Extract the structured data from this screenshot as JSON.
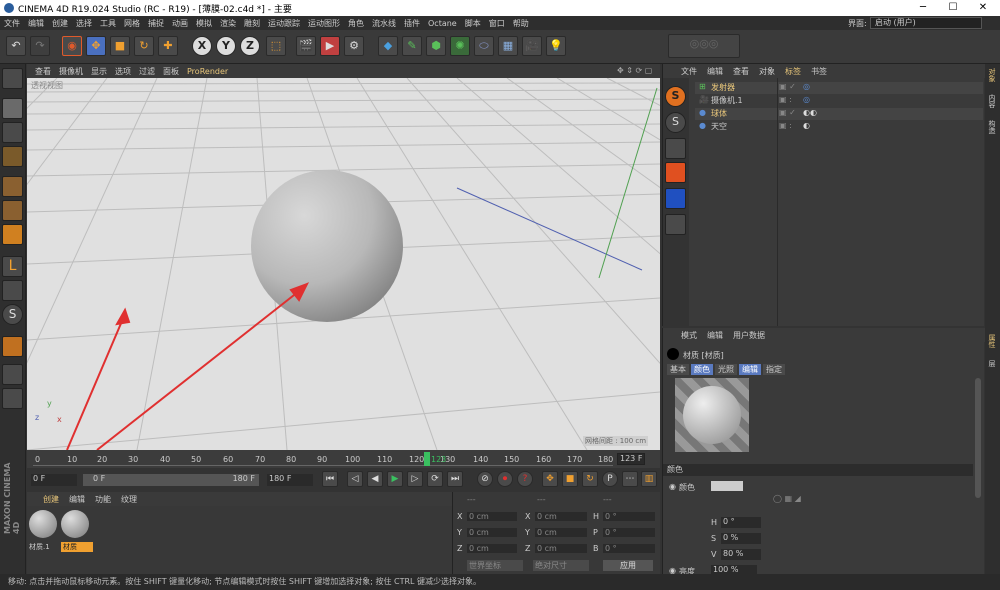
{
  "window": {
    "title": "CINEMA 4D R19.024 Studio (RC - R19) - [薄膜-02.c4d *] - 主要",
    "minimize": "─",
    "maximize": "☐",
    "close": "✕"
  },
  "menubar": {
    "items": [
      "文件",
      "编辑",
      "创建",
      "选择",
      "工具",
      "网格",
      "捕捉",
      "动画",
      "模拟",
      "渲染",
      "雕刻",
      "运动跟踪",
      "运动图形",
      "角色",
      "流水线",
      "插件",
      "Octane",
      "脚本",
      "窗口",
      "帮助"
    ],
    "interface_label": "界面:",
    "interface_value": "启动 (用户)"
  },
  "viewport": {
    "menu": [
      "查看",
      "摄像机",
      "显示",
      "选项",
      "过滤",
      "面板",
      "ProRender"
    ],
    "camera_label": "透视视图",
    "grid_spacing": "网格间距 : 100 cm"
  },
  "timeline": {
    "ticks": [
      "0",
      "10",
      "20",
      "30",
      "40",
      "50",
      "60",
      "70",
      "80",
      "90",
      "100",
      "110",
      "120",
      "130",
      "140",
      "150",
      "160",
      "170",
      "180"
    ],
    "current_frame": "123",
    "end_frame": "123 F"
  },
  "transport": {
    "start": "0 F",
    "min": "0 F",
    "max": "180 F",
    "end": "180 F"
  },
  "material_panel": {
    "tabs": [
      "创建",
      "编辑",
      "功能",
      "纹理"
    ],
    "materials": [
      {
        "name": "材质.1",
        "selected": false
      },
      {
        "name": "材质",
        "selected": true
      }
    ]
  },
  "coord_panel": {
    "headers": [
      "---",
      "---",
      "---"
    ],
    "rows": [
      {
        "a": "X",
        "av": "0 cm",
        "b": "X",
        "bv": "0 cm",
        "c": "H",
        "cv": "0 °"
      },
      {
        "a": "Y",
        "av": "0 cm",
        "b": "Y",
        "bv": "0 cm",
        "c": "P",
        "cv": "0 °"
      },
      {
        "a": "Z",
        "av": "0 cm",
        "b": "Z",
        "bv": "0 cm",
        "c": "B",
        "cv": "0 °"
      }
    ],
    "coord_mode": "世界坐标",
    "size_mode": "绝对尺寸",
    "apply": "应用"
  },
  "object_panel": {
    "menu": [
      "文件",
      "编辑",
      "查看",
      "对象",
      "标签",
      "书签"
    ],
    "objects": [
      {
        "name": "发射器",
        "depth": 0
      },
      {
        "name": "摄像机.1",
        "depth": 0
      },
      {
        "name": "球体",
        "depth": 0
      },
      {
        "name": "天空",
        "depth": 0
      }
    ]
  },
  "attr_panel": {
    "menu": [
      "模式",
      "编辑",
      "用户数据"
    ],
    "title": "材质 [材质]",
    "tabs": [
      "基本",
      "颜色",
      "光照",
      "编辑",
      "指定"
    ],
    "section": "颜色",
    "color_label": "颜色",
    "h_label": "H",
    "h_value": "0 °",
    "s_label": "S",
    "s_value": "0 %",
    "v_label": "V",
    "v_value": "80 %",
    "brightness_label": "亮度",
    "brightness_value": "100 %",
    "accent": "#e8c67a"
  },
  "right_strip": [
    "对象",
    "内容",
    "构造",
    "属性",
    "层"
  ],
  "status": "移动: 点击并拖动鼠标移动元素。按住 SHIFT 键量化移动; 节点编辑模式时按住 SHIFT 键增加选择对象; 按住 CTRL 键减少选择对象。"
}
